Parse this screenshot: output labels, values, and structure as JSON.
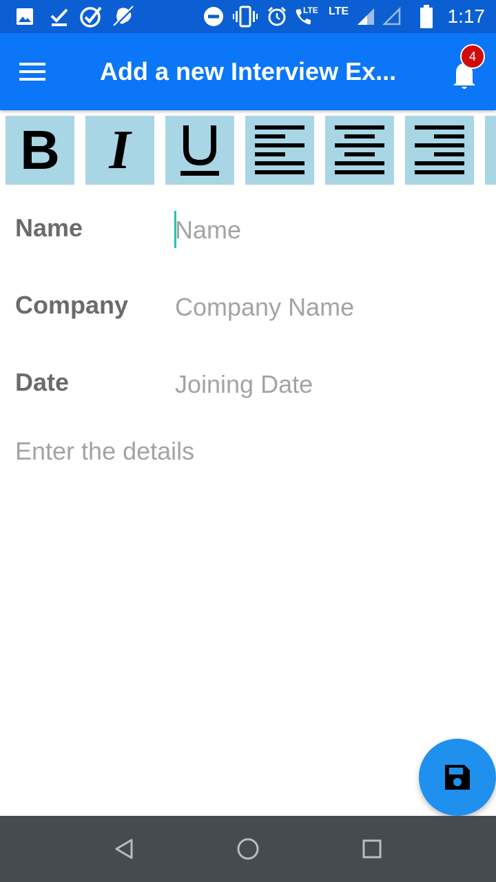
{
  "status_bar": {
    "time": "1:17",
    "lte_1": "LTE",
    "lte_2": "LTE",
    "icons": [
      "image-icon",
      "download-done-icon",
      "check-circle-icon",
      "mic-off-icon",
      "do-not-disturb-icon",
      "vibrate-icon",
      "alarm-icon",
      "volte-call-icon",
      "signal-icon",
      "signal-empty-icon",
      "battery-icon"
    ]
  },
  "app_bar": {
    "title": "Add a new Interview Ex...",
    "notification_count": "4",
    "color": "#0b76f7"
  },
  "toolbar": {
    "bold": "B",
    "italic": "I",
    "underline": "U",
    "align_buttons": [
      "align-left-icon",
      "align-center-icon",
      "align-right-icon"
    ],
    "button_color": "#a9d6e4"
  },
  "form": {
    "name_label": "Name",
    "name_placeholder": "Name",
    "name_value": "",
    "company_label": "Company",
    "company_placeholder": "Company Name",
    "company_value": "",
    "date_label": "Date",
    "date_placeholder": "Joining Date",
    "date_value": "",
    "details_placeholder": "Enter the details",
    "details_value": ""
  },
  "fab": {
    "icon": "save-icon",
    "color": "#1f90ee"
  },
  "nav": {
    "icons": [
      "back-icon",
      "home-icon",
      "recents-icon"
    ]
  }
}
